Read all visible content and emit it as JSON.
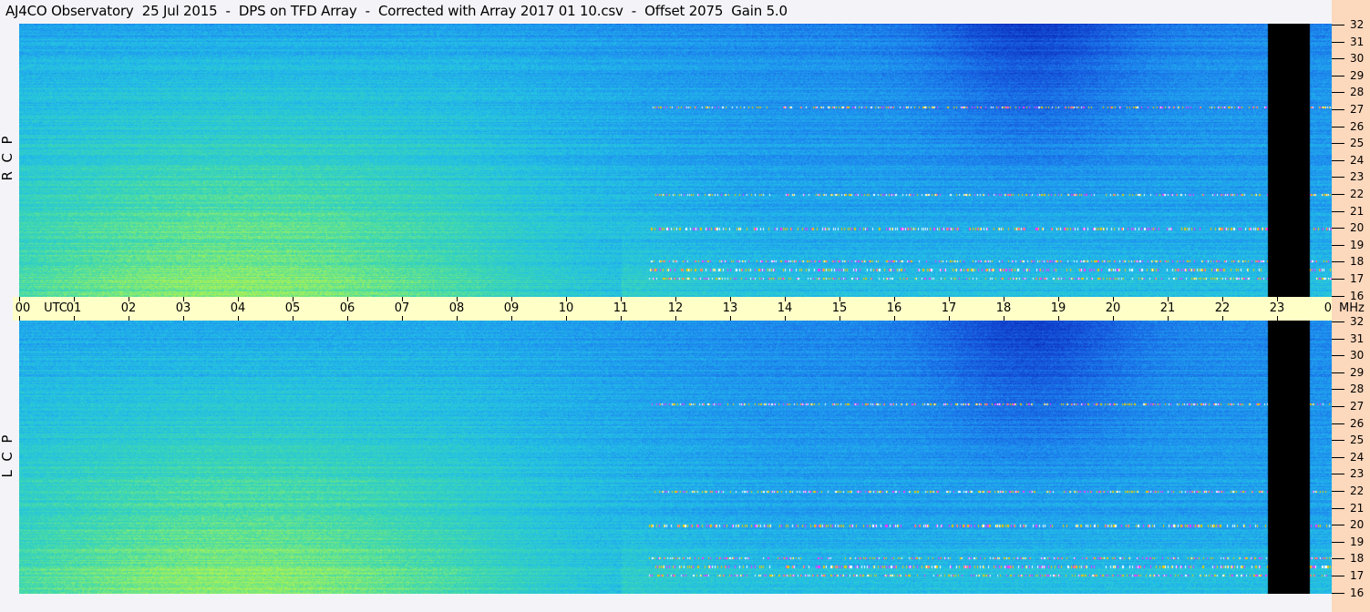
{
  "title": "AJ4CO Observatory  25 Jul 2015  -  DPS on TFD Array  -  Corrected with Array 2017 01 10.csv  -  Offset 2075  Gain 5.0",
  "chart_data": {
    "type": "heatmap",
    "title": "AJ4CO Observatory  25 Jul 2015  -  DPS on TFD Array  -  Corrected with Array 2017 01 10.csv  -  Offset 2075  Gain 5.0",
    "x_axis": {
      "unit_label": "UTC",
      "range": [
        0,
        24
      ],
      "tick_labels": [
        "00",
        "01",
        "02",
        "03",
        "04",
        "05",
        "06",
        "07",
        "08",
        "09",
        "10",
        "11",
        "12",
        "13",
        "14",
        "15",
        "16",
        "17",
        "18",
        "19",
        "20",
        "21",
        "22",
        "23",
        "00"
      ]
    },
    "y_axis": {
      "unit_label": "MHz",
      "range": [
        16,
        32
      ],
      "tick_labels": [
        "32",
        "31",
        "30",
        "29",
        "28",
        "27",
        "26",
        "25",
        "24",
        "23",
        "22",
        "21",
        "20",
        "19",
        "18",
        "17",
        "16"
      ]
    },
    "panels": [
      {
        "name": "R  C  P",
        "polarization": "RCP"
      },
      {
        "name": "L  C  P",
        "polarization": "LCP"
      }
    ],
    "data_gap_utc": [
      22.83,
      23.6
    ],
    "colormap": [
      "#0a2ab8",
      "#1656dc",
      "#1e8ef0",
      "#22c0e6",
      "#3ed8b0",
      "#9cf060",
      "#e8f020",
      "#ffffff",
      "#ff30ff"
    ],
    "interference_lines_mhz": [
      27.1,
      17.6,
      17.1,
      18.1,
      20.0,
      22.0
    ]
  },
  "colors": {
    "time_band": "#ffffc8",
    "freq_axis": "#fcd8bc",
    "gap": "#000000"
  }
}
